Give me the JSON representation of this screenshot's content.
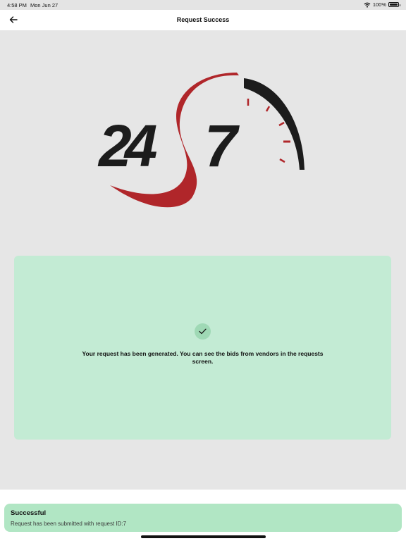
{
  "status_bar": {
    "time": "4:58 PM",
    "date": "Mon Jun 27",
    "battery": "100%",
    "icons": [
      "wifi-icon",
      "battery-icon"
    ]
  },
  "nav": {
    "title": "Request Success",
    "back_icon": "back-arrow-icon"
  },
  "logo": {
    "text_left": "24",
    "text_right": "7",
    "colors": {
      "dark": "#1c1c1c",
      "red": "#b0262a"
    }
  },
  "card": {
    "icon": "check-icon",
    "message": "Your request has been generated. You can see the bids from vendors in the requests screen.",
    "background": "#c3ebd4"
  },
  "toast": {
    "title": "Successful",
    "text": "Request has been submitted with request ID:7",
    "background": "#b1e6c4"
  }
}
